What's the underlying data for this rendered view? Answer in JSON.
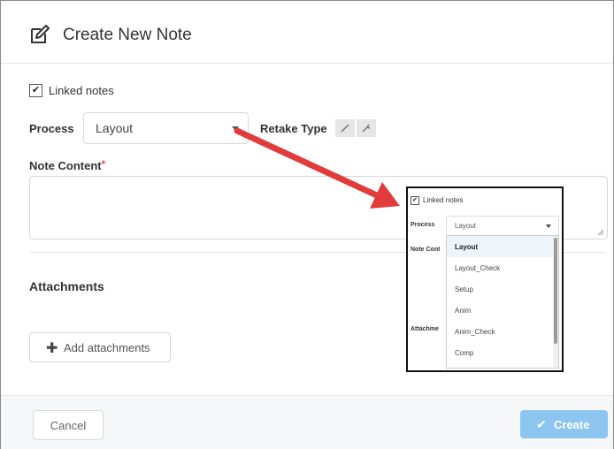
{
  "dialog": {
    "title": "Create New Note",
    "linked_notes_label": "Linked notes",
    "linked_notes_checked": true,
    "process_label": "Process",
    "process_value": "Layout",
    "retake_type_label": "Retake Type",
    "note_content_label": "Note Content",
    "required_mark": "*",
    "attachments_label": "Attachments",
    "add_attachments_label": "Add attachments",
    "cancel_label": "Cancel",
    "create_label": "Create"
  },
  "inset": {
    "linked_notes_label": "Linked notes",
    "process_label": "Process",
    "process_value": "Layout",
    "note_content_label": "Note Cont",
    "attachments_label": "Attachme",
    "options": [
      "Layout",
      "Layout_Check",
      "Setup",
      "Anim",
      "Anim_Check",
      "Comp"
    ],
    "selected_option": "Layout"
  },
  "colors": {
    "create_button": "#8cc6f0",
    "arrow": "#e23b3b",
    "required": "#e23b3b"
  },
  "icons": [
    "edit-note-icon",
    "checkmark-icon",
    "caret-down-icon",
    "brush-icon",
    "wrench-icon",
    "plus-icon"
  ]
}
